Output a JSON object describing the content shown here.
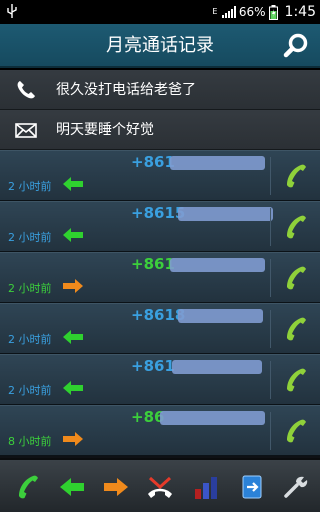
{
  "status_bar": {
    "network_letter": "E",
    "battery": "66%",
    "time": "1:45"
  },
  "header": {
    "title": "月亮通话记录"
  },
  "quick_actions": [
    {
      "icon": "phone-icon",
      "label": "很久没打电话给老爸了"
    },
    {
      "icon": "envelope-icon",
      "label": "明天要睡个好觉"
    }
  ],
  "calls": [
    {
      "number": "+861",
      "time": "2 小时前",
      "direction": "incoming",
      "color": "#3aa0e0",
      "time_color": "#3aa0e0"
    },
    {
      "number": "+8615",
      "time": "2 小时前",
      "direction": "incoming",
      "color": "#3aa0e0",
      "time_color": "#3aa0e0"
    },
    {
      "number": "+861",
      "time": "2 小时前",
      "direction": "outgoing",
      "color": "#3ccf3c",
      "time_color": "#3ccf3c"
    },
    {
      "number": "+8618",
      "time": "2 小时前",
      "direction": "incoming",
      "color": "#3aa0e0",
      "time_color": "#3aa0e0"
    },
    {
      "number": "+861",
      "time": "2 小时前",
      "direction": "incoming",
      "color": "#3aa0e0",
      "time_color": "#3aa0e0"
    },
    {
      "number": "+86",
      "time": "8 小时前",
      "direction": "outgoing",
      "color": "#3ccf3c",
      "time_color": "#3ccf3c"
    }
  ],
  "toolbar": [
    "all-calls-icon",
    "incoming-calls-icon",
    "outgoing-calls-icon",
    "missed-calls-icon",
    "statistics-icon",
    "export-icon",
    "settings-wrench-icon"
  ],
  "colors": {
    "incoming_arrow": "#2fd12f",
    "outgoing_arrow": "#f08a1c",
    "call_button": "#8fd13a"
  }
}
